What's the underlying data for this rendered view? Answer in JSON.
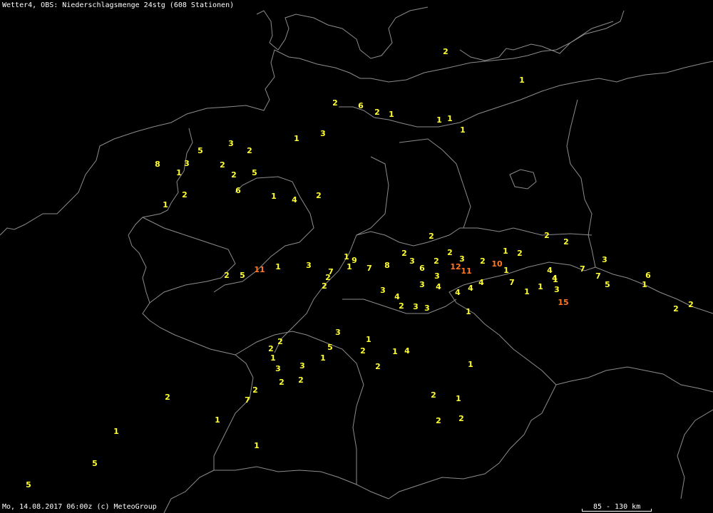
{
  "header": {
    "title": "Wetter4, OBS: Niederschlagsmenge 24stg (608 Stationen)"
  },
  "footer": {
    "timestamp": "Mo, 14.08.2017 06:00z (c) MeteoGroup"
  },
  "scale": {
    "label": "85 - 130 km"
  },
  "colors": {
    "background": "#000000",
    "border": "#8c8c8c",
    "low": "#ffff33",
    "high": "#ff7722",
    "text": "#ffffff"
  },
  "stations": [
    "2",
    "1",
    "2",
    "6",
    "2",
    "1",
    "1",
    "1",
    "1",
    "1",
    "3",
    "3",
    "5",
    "2",
    "8",
    "3",
    "1",
    "2",
    "2",
    "5",
    "6",
    "1",
    "4",
    "2",
    "2",
    "1",
    "2",
    "2",
    "2",
    "2",
    "1",
    "2",
    "2",
    "3",
    "6",
    "2",
    "3",
    "12",
    "11",
    "10",
    "2",
    "1",
    "4",
    "7",
    "3",
    "1",
    "1",
    "9",
    "7",
    "7",
    "8",
    "3",
    "2",
    "2",
    "2",
    "3",
    "4",
    "4",
    "4",
    "4",
    "7",
    "3",
    "4",
    "3",
    "3",
    "2",
    "1",
    "1",
    "1",
    "1",
    "3",
    "4",
    "7",
    "5",
    "6",
    "1",
    "15",
    "2",
    "2",
    "5",
    "11",
    "1",
    "3",
    "2",
    "1",
    "2",
    "3",
    "3",
    "2",
    "2",
    "1",
    "5",
    "3",
    "1",
    "2",
    "2",
    "1",
    "4",
    "1",
    "2",
    "1",
    "2",
    "2",
    "2",
    "7",
    "2",
    "1",
    "1",
    "1",
    "5",
    "5",
    "2",
    "1"
  ]
}
